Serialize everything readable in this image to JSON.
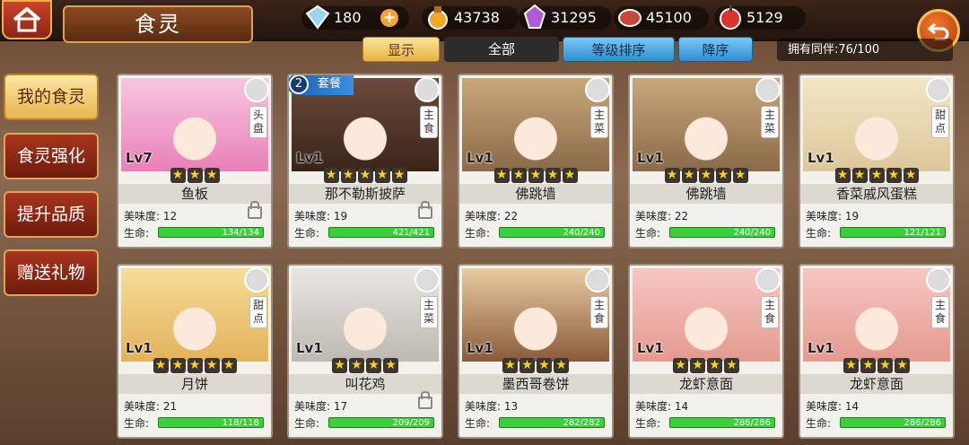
{
  "header": {
    "title": "食灵",
    "resources": [
      {
        "icon": "diamond-icon",
        "value": "180"
      },
      {
        "icon": "gold-potion-icon",
        "value": "43738"
      },
      {
        "icon": "crystal-icon",
        "value": "31295"
      },
      {
        "icon": "meat-icon",
        "value": "45100"
      },
      {
        "icon": "apple-icon",
        "value": "5129"
      }
    ],
    "add_label": "+"
  },
  "filters": {
    "show": "显示",
    "all": "全部",
    "sort": "等级排序",
    "desc": "降序",
    "owned": "拥有同伴:76/100"
  },
  "sidebar": {
    "items": [
      {
        "label": "我的食灵"
      },
      {
        "label": "食灵强化"
      },
      {
        "label": "提升品质"
      },
      {
        "label": "赠送礼物"
      }
    ]
  },
  "labels": {
    "taste": "美味度:",
    "hp": "生命:",
    "set": "套餐",
    "set_count": "2"
  },
  "cards": [
    {
      "level": "Lv7",
      "stars": 3,
      "name": "鱼板",
      "taste": "12",
      "hp": "134/134",
      "category": "头盘",
      "locked": true
    },
    {
      "level": "Lv1",
      "stars": 5,
      "name": "那不勒斯披萨",
      "taste": "19",
      "hp": "421/421",
      "category": "主食",
      "locked": true
    },
    {
      "level": "Lv1",
      "stars": 5,
      "name": "佛跳墙",
      "taste": "22",
      "hp": "240/240",
      "category": "主菜",
      "locked": false
    },
    {
      "level": "Lv1",
      "stars": 5,
      "name": "佛跳墙",
      "taste": "22",
      "hp": "240/240",
      "category": "主菜",
      "locked": false
    },
    {
      "level": "Lv1",
      "stars": 5,
      "name": "香菜戚风蛋糕",
      "taste": "19",
      "hp": "121/121",
      "category": "甜点",
      "locked": false
    },
    {
      "level": "Lv1",
      "stars": 5,
      "name": "月饼",
      "taste": "21",
      "hp": "118/118",
      "category": "甜点",
      "locked": false
    },
    {
      "level": "Lv1",
      "stars": 4,
      "name": "叫花鸡",
      "taste": "17",
      "hp": "209/209",
      "category": "主菜",
      "locked": true
    },
    {
      "level": "Lv1",
      "stars": 4,
      "name": "墨西哥卷饼",
      "taste": "13",
      "hp": "282/282",
      "category": "主食",
      "locked": false
    },
    {
      "level": "Lv1",
      "stars": 4,
      "name": "龙虾意面",
      "taste": "14",
      "hp": "286/286",
      "category": "主食",
      "locked": false
    },
    {
      "level": "Lv1",
      "stars": 4,
      "name": "龙虾意面",
      "taste": "14",
      "hp": "286/286",
      "category": "主食",
      "locked": false
    }
  ],
  "colors": {
    "active_tab": "#e7b64d",
    "sort_blue": "#2f8fd0",
    "hp_green": "#3ccf3c"
  }
}
